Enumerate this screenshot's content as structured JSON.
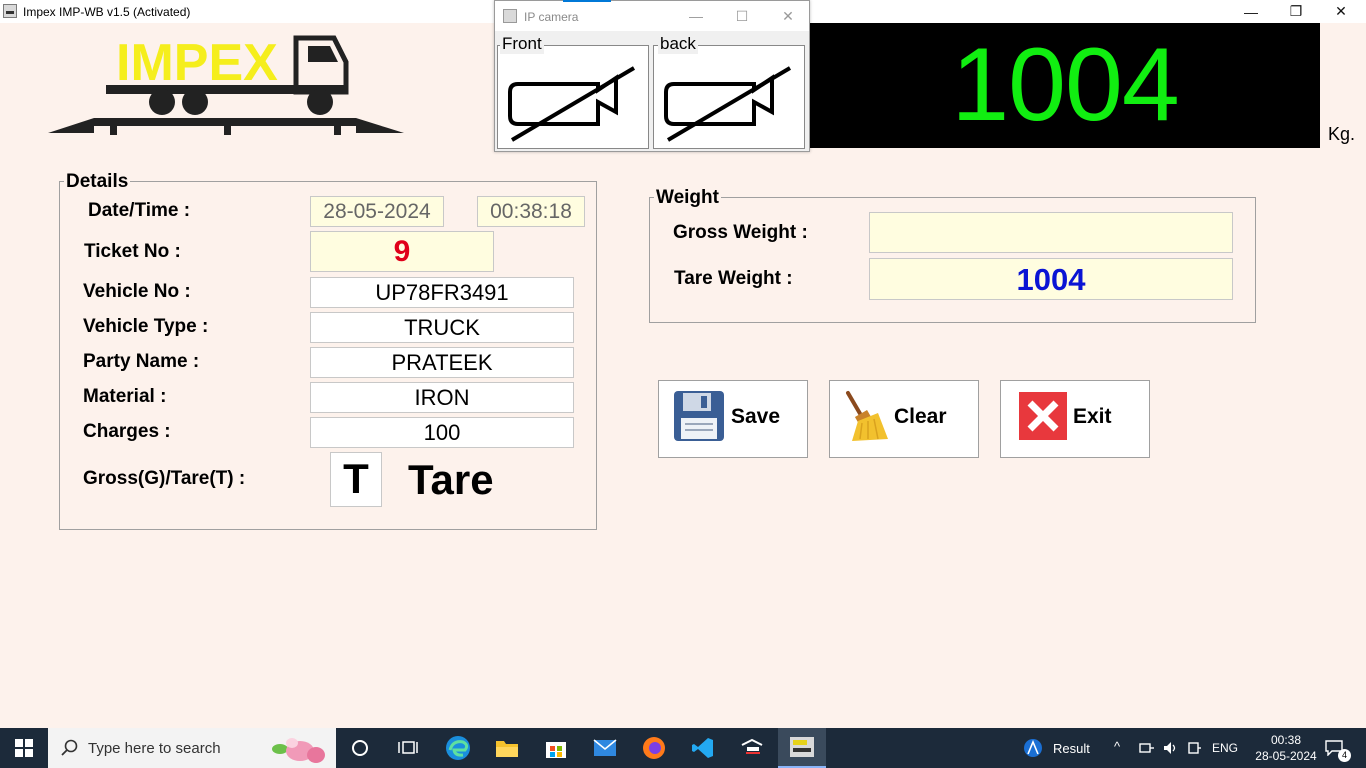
{
  "window": {
    "title": "Impex IMP-WB v1.5 (Activated)",
    "controls": {
      "minimize": "—",
      "restore": "❐",
      "close": "✕"
    }
  },
  "logo": {
    "text": "IMPEX",
    "text_color": "#f5ee1c"
  },
  "ip_camera": {
    "title": "IP camera",
    "controls": {
      "minimize": "—",
      "maximize": "☐",
      "close": "✕"
    },
    "front_label": "Front",
    "back_label": "back"
  },
  "display": {
    "weight": "1004",
    "unit": "Kg.",
    "color": "#11ee11"
  },
  "details": {
    "legend": "Details",
    "datetime_label": "Date/Time :",
    "date_value": "28-05-2024",
    "time_value": "00:38:18",
    "ticket_label": "Ticket No :",
    "ticket_value": "9",
    "vehicle_no_label": "Vehicle No :",
    "vehicle_no_value": "UP78FR3491",
    "vehicle_type_label": "Vehicle Type :",
    "vehicle_type_value": "TRUCK",
    "party_label": "Party Name :",
    "party_value": "PRATEEK",
    "material_label": "Material :",
    "material_value": "IRON",
    "charges_label": "Charges :",
    "charges_value": "100",
    "gt_label": "Gross(G)/Tare(T) :",
    "gt_value": "T",
    "gt_text": "Tare"
  },
  "weight_group": {
    "legend": "Weight",
    "gross_label": "Gross Weight :",
    "gross_value": "",
    "tare_label": "Tare Weight :",
    "tare_value": "1004"
  },
  "buttons": {
    "save": "Save",
    "clear": "Clear",
    "exit": "Exit"
  },
  "taskbar": {
    "search_placeholder": "Type here to search",
    "weather_text": "Result",
    "language": "ENG",
    "time": "00:38",
    "date": "28-05-2024",
    "notification_count": "4"
  },
  "colors": {
    "ticket": "#e0001a",
    "tare_weight": "#0a14d4",
    "taskbar": "#1c2a3a"
  }
}
